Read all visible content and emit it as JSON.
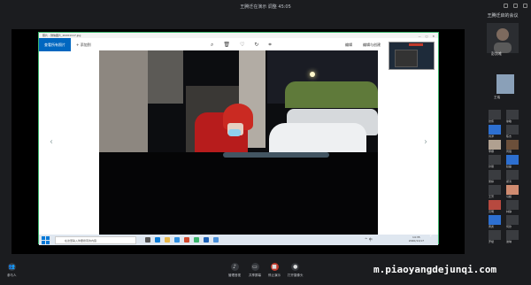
{
  "top_title": "王腾迁在演示 调整 45:05",
  "sidebar": {
    "title": "王腾迁启的会议",
    "big_name": "彭剑唯",
    "small_name": "王瑞",
    "tiles": [
      {
        "name": "张伟",
        "color": "#3a3c40"
      },
      {
        "name": "徐敏",
        "color": "#3a3c40"
      },
      {
        "name": "刘洋",
        "color": "#2d6fd0"
      },
      {
        "name": "陈杰",
        "color": "#3a3c40"
      },
      {
        "name": "李娜",
        "color": "#b0a090"
      },
      {
        "name": "周强",
        "color": "#6b4f3a"
      },
      {
        "name": "孙丽",
        "color": "#3a3c40"
      },
      {
        "name": "赵磊",
        "color": "#2d6fd0"
      },
      {
        "name": "吴婷",
        "color": "#3a3c40"
      },
      {
        "name": "郑涛",
        "color": "#3a3c40"
      },
      {
        "name": "王芳",
        "color": "#3a3c40"
      },
      {
        "name": "马超",
        "color": "#d08b70"
      },
      {
        "name": "高明",
        "color": "#b7493f"
      },
      {
        "name": "林静",
        "color": "#3a3c40"
      },
      {
        "name": "黄勇",
        "color": "#2d6fd0"
      },
      {
        "name": "何欣",
        "color": "#3a3c40"
      },
      {
        "name": "罗斌",
        "color": "#3a3c40"
      },
      {
        "name": "谢琳",
        "color": "#3a3c40"
      }
    ]
  },
  "photos": {
    "window_title": "照片 - 微信图片_20201117.jpg",
    "blue_button": "查看所有照片",
    "add_label": "添加到",
    "edit_label": "编辑",
    "more_label": "编辑与创建"
  },
  "taskbar": {
    "search_placeholder": "在这里输入你要搜索的内容",
    "time": "14:35",
    "date": "2020/11/17",
    "tray": "^ 中"
  },
  "bottom": {
    "left_label": "参与人",
    "items": [
      "管理音视",
      "共享屏幕",
      "停止演示",
      "打开摄像头"
    ]
  },
  "watermark": "m.piaoyangdejunqi.com"
}
